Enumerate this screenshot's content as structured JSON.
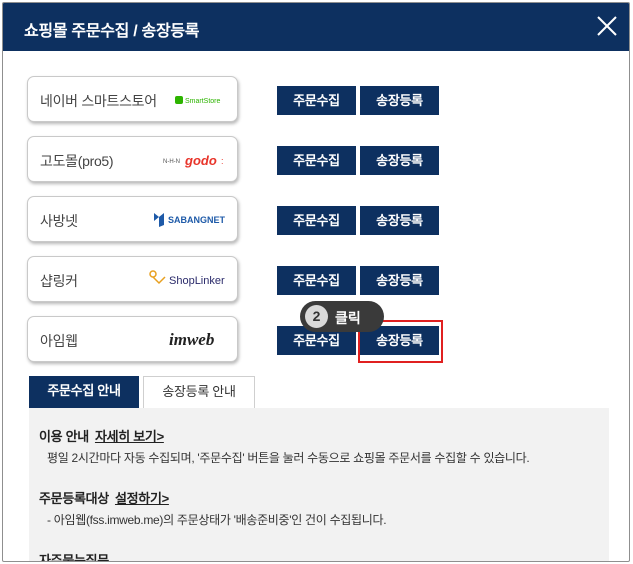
{
  "dialog": {
    "title": "쇼핑몰 주문수집 / 송장등록"
  },
  "malls": [
    {
      "name": "네이버 스마트스토어",
      "logo_text": "SmartStore",
      "logo_color": "#2db400"
    },
    {
      "name": "고도몰(pro5)",
      "logo_text": "godo",
      "logo_color": "#e8342a"
    },
    {
      "name": "사방넷",
      "logo_text": "SABANGNET",
      "logo_color": "#1e5aa8"
    },
    {
      "name": "샵링커",
      "logo_text": "ShopLinker",
      "logo_color": "#2a2a6a"
    },
    {
      "name": "아임웹",
      "logo_text": "imweb",
      "logo_color": "#222222"
    }
  ],
  "buttons": {
    "collect_label": "주문수집",
    "invoice_label": "송장등록"
  },
  "callout": {
    "number": "2",
    "text": "클릭"
  },
  "tabs": [
    {
      "label": "주문수집 안내",
      "active": true
    },
    {
      "label": "송장등록 안내",
      "active": false
    }
  ],
  "info": {
    "usage_title": "이용 안내",
    "usage_link": "자세히 보기>",
    "usage_desc": "평일 2시간마다 자동 수집되며, '주문수집' 버튼을 눌러 수동으로 쇼핑몰 주문서를 수집할 수 있습니다.",
    "target_title": "주문등록대상",
    "target_link": "설정하기>",
    "target_desc": "- 아임웹(fss.imweb.me)의 주문상태가 '배송준비중'인 건이 수집됩니다.",
    "faq_title": "자주묻는질문"
  },
  "colors": {
    "primary": "#0d3060",
    "highlight": "#e02020"
  }
}
